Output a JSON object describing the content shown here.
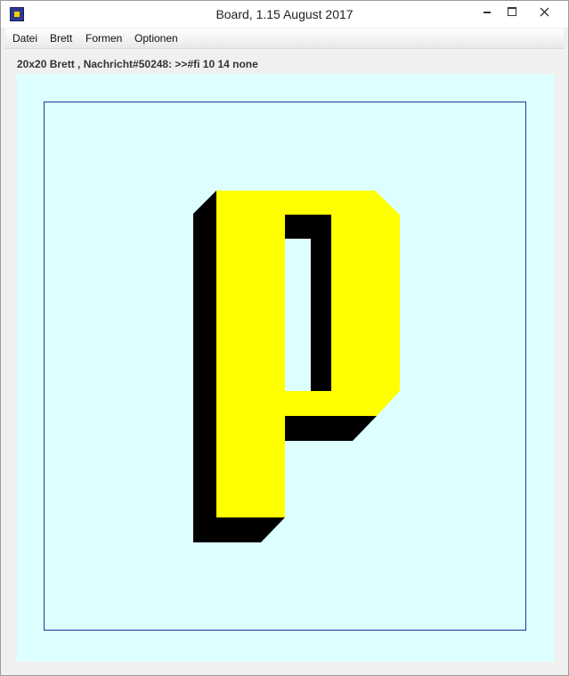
{
  "window": {
    "title": "Board, 1.15 August 2017"
  },
  "menubar": {
    "items": [
      {
        "label": "Datei"
      },
      {
        "label": "Brett"
      },
      {
        "label": "Formen"
      },
      {
        "label": "Optionen"
      }
    ]
  },
  "status": {
    "text": "20x20 Brett , Nachricht#50248: >>#fi 10 14 none"
  },
  "board": {
    "background": "#deffff",
    "frame_color": "#1a3c9c",
    "glyph": "p",
    "glyph_fill": "#ffff00",
    "glyph_shadow": "#000000"
  },
  "icons": {
    "app": "board-app-icon",
    "minimize": "minimize-icon",
    "maximize": "maximize-icon",
    "close": "close-icon"
  }
}
